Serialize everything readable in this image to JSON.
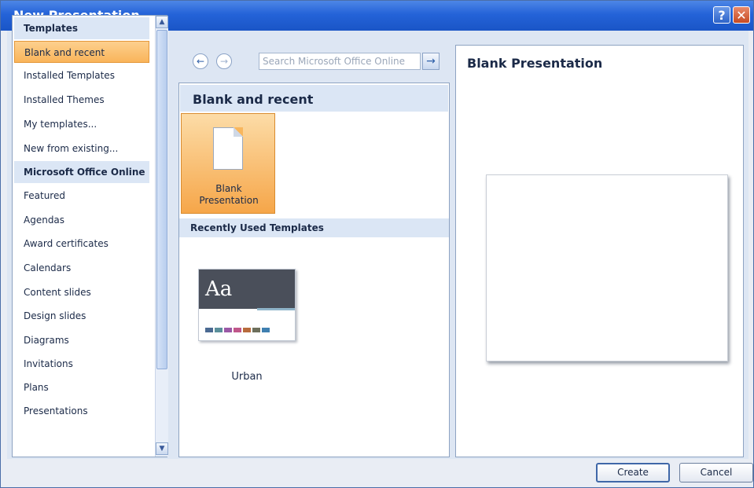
{
  "window": {
    "title": "New Presentation",
    "help_label": "?",
    "close_label": "✕"
  },
  "sidebar": {
    "items": [
      {
        "label": "Templates",
        "kind": "header"
      },
      {
        "label": "Blank and recent",
        "kind": "selected"
      },
      {
        "label": "Installed Templates",
        "kind": "item"
      },
      {
        "label": "Installed Themes",
        "kind": "item"
      },
      {
        "label": "My templates...",
        "kind": "item"
      },
      {
        "label": "New from existing...",
        "kind": "item"
      },
      {
        "label": "Microsoft Office Online",
        "kind": "header"
      },
      {
        "label": "Featured",
        "kind": "item"
      },
      {
        "label": "Agendas",
        "kind": "item"
      },
      {
        "label": "Award certificates",
        "kind": "item"
      },
      {
        "label": "Calendars",
        "kind": "item"
      },
      {
        "label": "Content slides",
        "kind": "item"
      },
      {
        "label": "Design slides",
        "kind": "item"
      },
      {
        "label": "Diagrams",
        "kind": "item"
      },
      {
        "label": "Invitations",
        "kind": "item"
      },
      {
        "label": "Plans",
        "kind": "item"
      },
      {
        "label": "Presentations",
        "kind": "item"
      }
    ],
    "scroll_up_icon": "chevron-up-icon",
    "scroll_down_icon": "chevron-down-icon"
  },
  "navigation": {
    "back_icon": "back-arrow-icon",
    "forward_icon": "forward-arrow-icon",
    "back_label": "←",
    "forward_label": "→",
    "search_placeholder": "Search Microsoft Office Online",
    "search_go_label": "→"
  },
  "main": {
    "section_title": "Blank and recent",
    "blank_tile_label_line1": "Blank",
    "blank_tile_label_line2": "Presentation",
    "recent_section_title": "Recently Used Templates",
    "recent_templates": [
      {
        "name": "Urban",
        "thumb_text": "Aa"
      }
    ]
  },
  "preview": {
    "title": "Blank Presentation"
  },
  "footer": {
    "create_label": "Create",
    "cancel_label": "Cancel"
  },
  "colors": {
    "titlebar": "#2463d8",
    "selection": "#f9b45a",
    "panel_header": "#dbe6f5",
    "urban_swatches": [
      "#4b6a92",
      "#5b8f9b",
      "#9b59a6",
      "#c0578a",
      "#b86b3c",
      "#6d6f5c",
      "#3f7fb0"
    ]
  }
}
